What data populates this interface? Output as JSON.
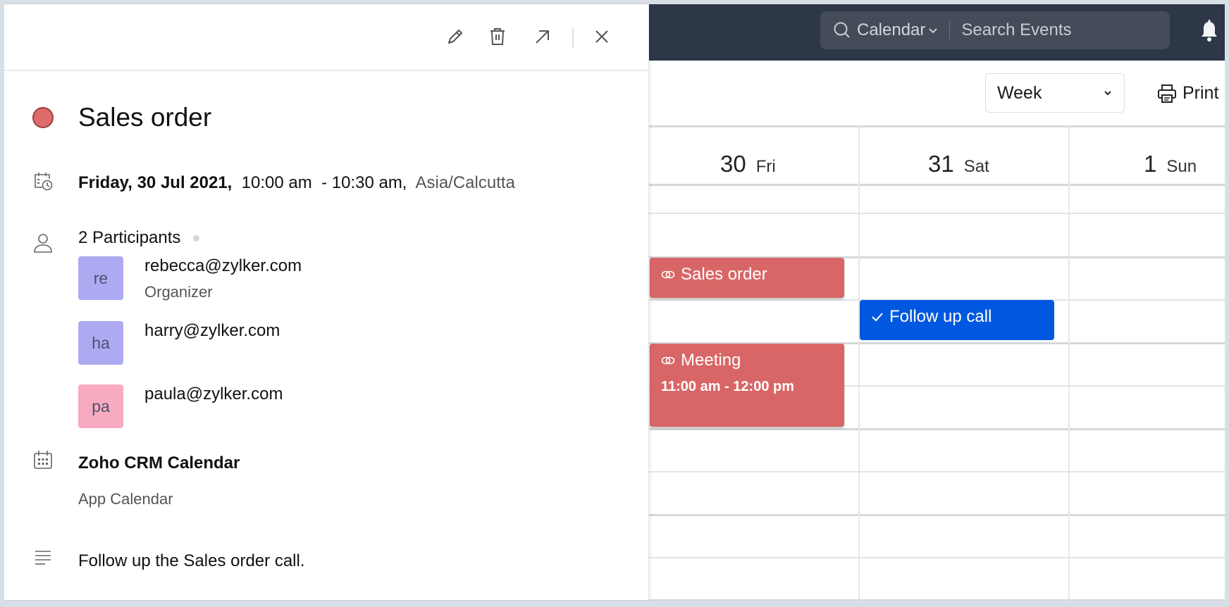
{
  "header": {
    "search": {
      "scope_label": "Calendar",
      "placeholder": "Search Events"
    },
    "icons": [
      "search-icon",
      "chevron-down-icon",
      "bell-icon"
    ]
  },
  "toolbar": {
    "view_select": {
      "selected": "Week"
    },
    "print_label": "Print"
  },
  "calendar": {
    "days": [
      {
        "num": "30",
        "name": "Fri"
      },
      {
        "num": "31",
        "name": "Sat"
      },
      {
        "num": "1",
        "name": "Sun"
      }
    ],
    "events": [
      {
        "title": "Sales order",
        "icon": "link-icon",
        "color": "#d96666",
        "time": ""
      },
      {
        "title": "Follow up call",
        "icon": "check-icon",
        "color": "#0058e0",
        "time": ""
      },
      {
        "title": "Meeting",
        "icon": "link-icon",
        "color": "#d96666",
        "time": "11:00 am - 12:00 pm"
      }
    ]
  },
  "detail": {
    "actions": [
      "edit",
      "delete",
      "open-external",
      "close"
    ],
    "title": "Sales order",
    "title_color": "#dd6b6b",
    "date": "Friday, 30 Jul 2021,",
    "time_range": "  10:00 am  - 10:30 am,",
    "timezone": "  Asia/Calcutta",
    "participants_label": "2 Participants",
    "participants": [
      {
        "initials": "re",
        "email": "rebecca@zylker.com",
        "role": "Organizer",
        "color": "#aeaaf2"
      },
      {
        "initials": "ha",
        "email": "harry@zylker.com",
        "role": "",
        "color": "#aeaaf2"
      },
      {
        "initials": "pa",
        "email": "paula@zylker.com",
        "role": "",
        "color": "#f8abc0"
      }
    ],
    "calendar_name": "Zoho CRM Calendar",
    "calendar_type": "App Calendar",
    "description": "Follow up the Sales order call."
  }
}
